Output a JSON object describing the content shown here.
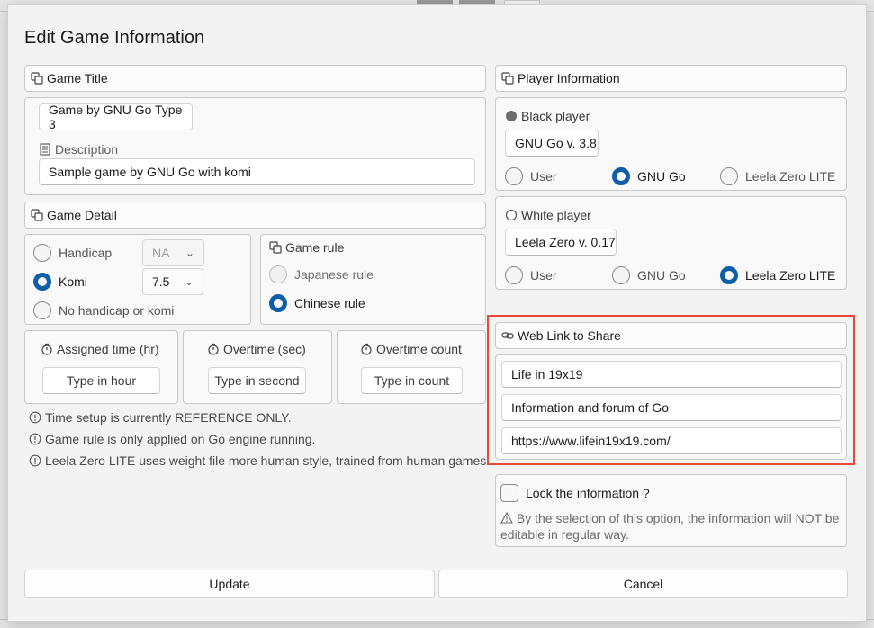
{
  "dialog": {
    "title": "Edit Game Information"
  },
  "game_title": {
    "header": "Game Title",
    "title_value": "Game by GNU Go Type 3",
    "description_label": "Description",
    "description_value": "Sample game by GNU Go with komi"
  },
  "game_detail": {
    "header": "Game Detail",
    "handicap_label": "Handicap",
    "handicap_value": "NA",
    "komi_label": "Komi",
    "komi_value": "7.5",
    "none_label": "No handicap or komi",
    "selected": "Komi",
    "game_rule_label": "Game rule",
    "japanese_rule": "Japanese rule",
    "chinese_rule": "Chinese rule",
    "selected_rule": "Chinese rule"
  },
  "timing": {
    "assigned_label": "Assigned time (hr)",
    "assigned_placeholder": "Type in hour",
    "overtime_label": "Overtime (sec)",
    "overtime_placeholder": "Type in second",
    "overtime_count_label": "Overtime count",
    "overtime_count_placeholder": "Type in count"
  },
  "notes": [
    "Time setup is currently REFERENCE ONLY.",
    "Game rule is only applied on Go engine running.",
    "Leela Zero LITE uses weight file more human style, trained from human games."
  ],
  "player_info": {
    "header": "Player Information",
    "black": {
      "label": "Black player",
      "name": "GNU Go v. 3.8",
      "options": [
        "User",
        "GNU Go",
        "Leela Zero LITE"
      ],
      "selected": "GNU Go"
    },
    "white": {
      "label": "White player",
      "name": "Leela Zero v. 0.17",
      "options": [
        "User",
        "GNU Go",
        "Leela Zero LITE"
      ],
      "selected": "Leela Zero LITE"
    }
  },
  "web_link": {
    "header": "Web Link to Share",
    "site_name": "Life in 19x19",
    "site_description": "Information and forum of Go",
    "url": "https://www.lifein19x19.com/"
  },
  "lock": {
    "label": "Lock the information ?",
    "checked": false,
    "warning": "By the selection of this option, the information will NOT be editable in regular way."
  },
  "buttons": {
    "update": "Update",
    "cancel": "Cancel"
  },
  "colors": {
    "accent": "#0f5ea8",
    "highlight": "#e8473c"
  }
}
